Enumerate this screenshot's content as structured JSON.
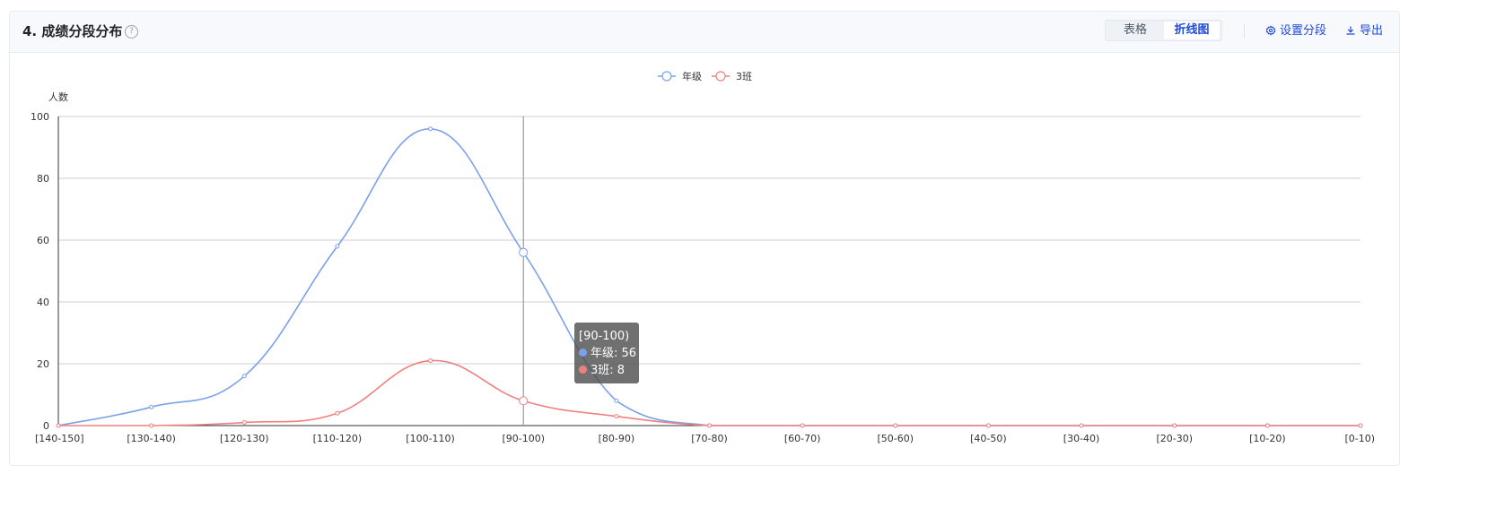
{
  "header": {
    "title": "4. 成绩分段分布",
    "help_icon": "question-circle-icon",
    "view_toggle": {
      "options": [
        "表格",
        "折线图"
      ],
      "selected": "折线图"
    },
    "actions": {
      "settings_label": "设置分段",
      "settings_icon": "gear-icon",
      "export_label": "导出",
      "export_icon": "download-icon"
    }
  },
  "chart_data": {
    "type": "line",
    "smooth": true,
    "ylabel": "人数",
    "ylim": [
      0,
      100
    ],
    "yticks": [
      0,
      20,
      40,
      60,
      80,
      100
    ],
    "grid": true,
    "legend_position": "top-center",
    "categories": [
      "[140-150]",
      "[130-140)",
      "[120-130)",
      "[110-120)",
      "[100-110)",
      "[90-100)",
      "[80-90)",
      "[70-80)",
      "[60-70)",
      "[50-60)",
      "[40-50)",
      "[30-40)",
      "[20-30)",
      "[10-20)",
      "[0-10)"
    ],
    "series": [
      {
        "name": "年级",
        "color": "#7ba1ec",
        "values": [
          0,
          6,
          16,
          58,
          96,
          56,
          8,
          0,
          0,
          0,
          0,
          0,
          0,
          0,
          0
        ]
      },
      {
        "name": "3班",
        "color": "#f08080",
        "values": [
          0,
          0,
          1,
          4,
          21,
          8,
          3,
          0,
          0,
          0,
          0,
          0,
          0,
          0,
          0
        ]
      }
    ],
    "hover": {
      "category_index": 5,
      "label": "[90-100)",
      "rows": [
        {
          "text": "年级: 56",
          "color": "#7ba1ec"
        },
        {
          "text": "3班: 8",
          "color": "#f08080"
        }
      ]
    }
  }
}
